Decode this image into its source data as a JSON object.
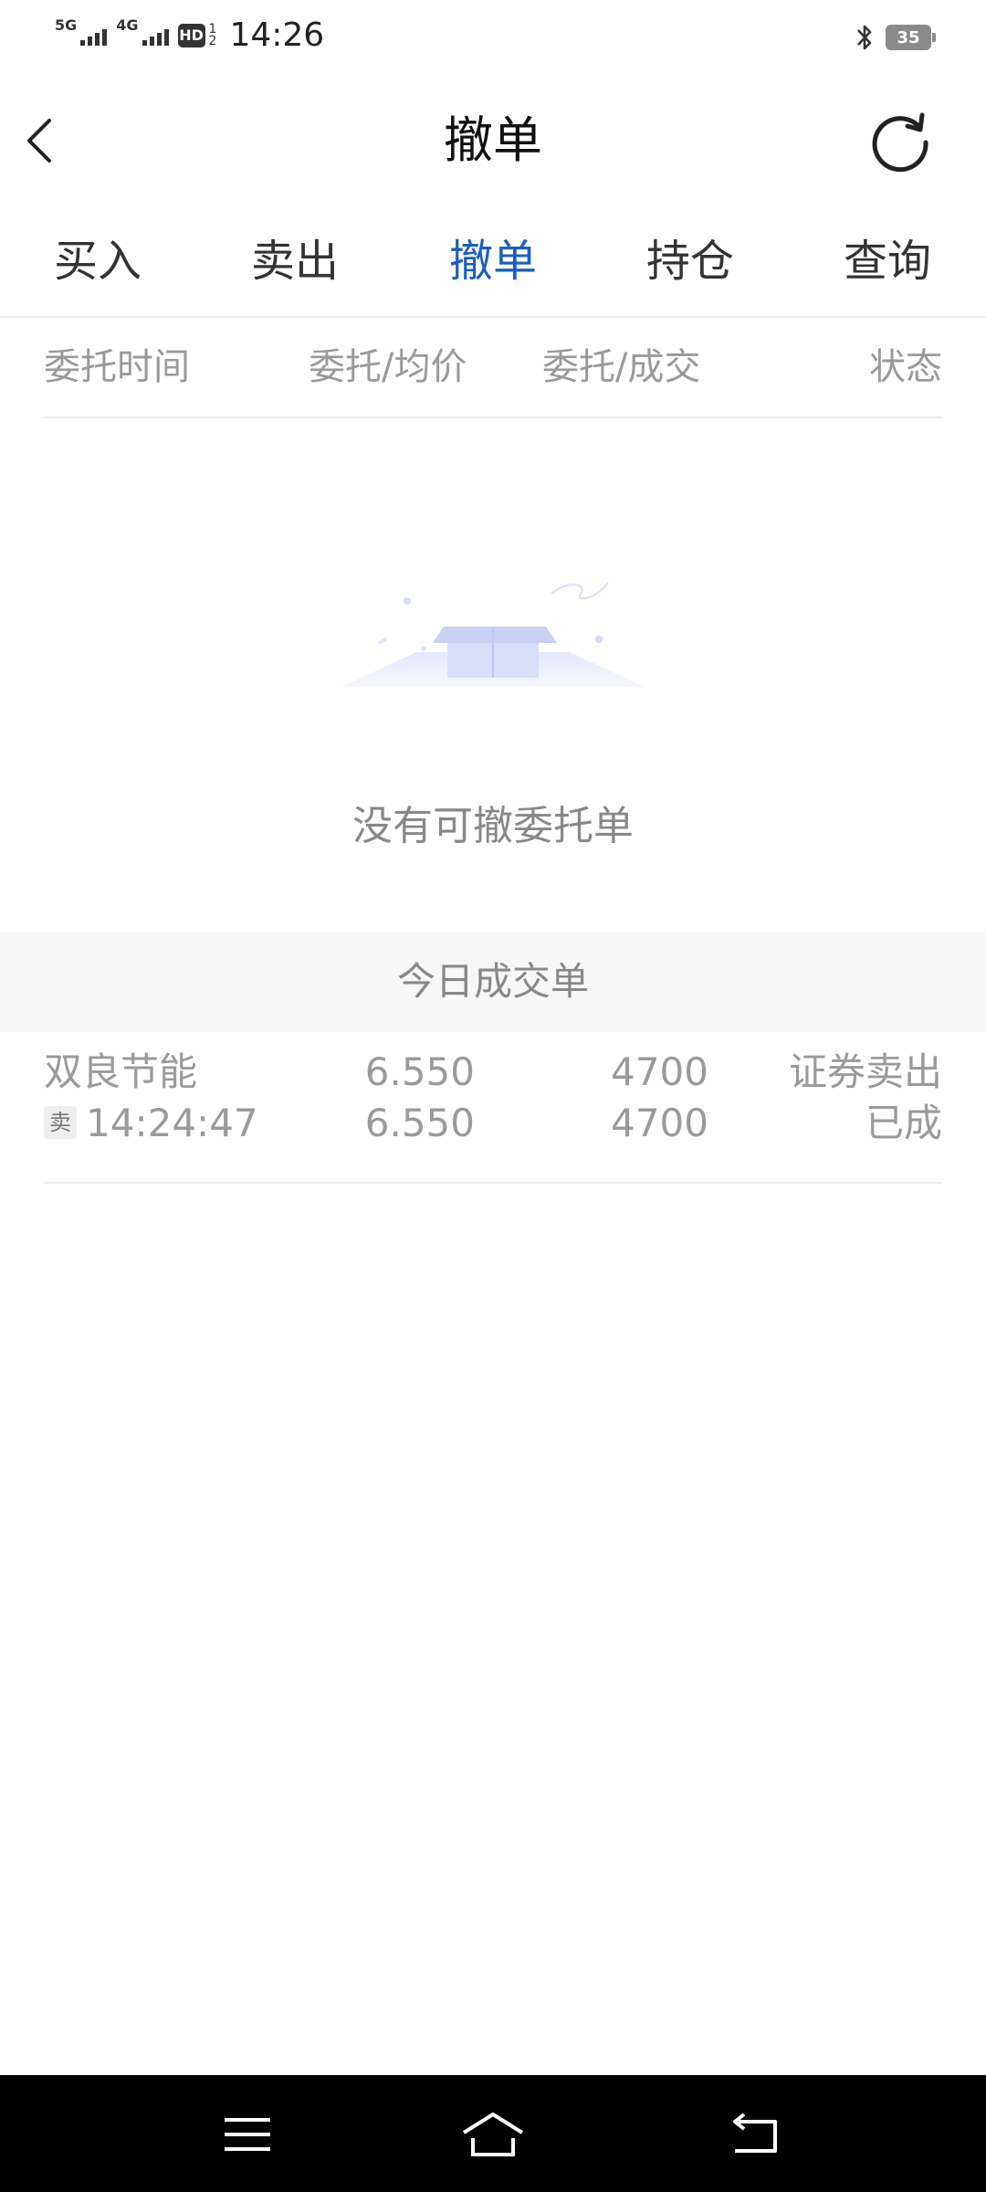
{
  "status_bar": {
    "net1": "5G",
    "net2": "4G",
    "hd": "HD",
    "sim_top": "1",
    "sim_bottom": "2",
    "time": "14:26",
    "battery": "35",
    "icons": [
      "signal-icon",
      "bluetooth-icon",
      "battery-icon"
    ]
  },
  "header": {
    "title": "撤单",
    "back_icon": "chevron-left-icon",
    "refresh_icon": "refresh-icon"
  },
  "tabs": [
    {
      "label": "买入"
    },
    {
      "label": "卖出"
    },
    {
      "label": "撤单"
    },
    {
      "label": "持仓"
    },
    {
      "label": "查询"
    }
  ],
  "active_tab": "撤单",
  "columns": [
    "委托时间",
    "委托/均价",
    "委托/成交",
    "状态"
  ],
  "empty_state": {
    "message": "没有可撤委托单"
  },
  "today_section": {
    "title": "今日成交单",
    "rows": [
      {
        "name": "双良节能",
        "side": "卖",
        "time": "14:24:47",
        "order_price": "6.550",
        "avg_price": "6.550",
        "order_qty": "4700",
        "filled_qty": "4700",
        "type": "证券卖出",
        "status": "已成"
      }
    ]
  },
  "colors": {
    "accent": "#1a5fbf",
    "muted_text": "#9a9a9a",
    "band_bg": "#f7f7f7",
    "nav_bg": "#000000"
  },
  "bottom_nav": [
    "menu-icon",
    "home-icon",
    "back-icon"
  ]
}
